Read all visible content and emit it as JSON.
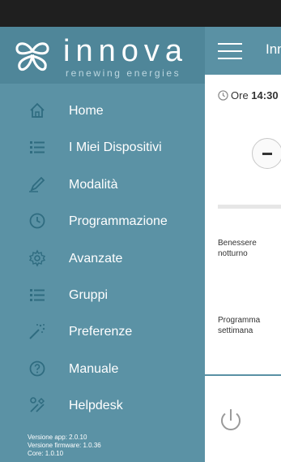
{
  "drawer": {
    "brand": "innova",
    "tagline": "renewing energies",
    "items": [
      {
        "label": "Home",
        "icon": "home-icon"
      },
      {
        "label": "I Miei Dispositivi",
        "icon": "list-icon"
      },
      {
        "label": "Modalità",
        "icon": "pencil-icon"
      },
      {
        "label": "Programmazione",
        "icon": "clock-icon"
      },
      {
        "label": "Avanzate",
        "icon": "gear-icon"
      },
      {
        "label": "Gruppi",
        "icon": "list-icon"
      },
      {
        "label": "Preferenze",
        "icon": "magic-wand-icon"
      },
      {
        "label": "Manuale",
        "icon": "help-icon"
      },
      {
        "label": "Helpdesk",
        "icon": "tools-icon"
      }
    ],
    "versions": {
      "app": "Versione app: 2.0.10",
      "firmware": "Versione firmware: 1.0.36",
      "core": "Core: 1.0.10"
    }
  },
  "topbar": {
    "title": "Innova"
  },
  "main": {
    "time_prefix": "Ore",
    "time_value": "14:30",
    "night_label_1": "Benessere",
    "night_label_2": "notturno",
    "weekly_label_1": "Programma",
    "weekly_label_2": "settimana"
  },
  "colors": {
    "drawer": "#5b92a5",
    "drawer_header": "#4f8699",
    "topbar": "#5a91a4",
    "status_bar": "#1f1f1f"
  }
}
